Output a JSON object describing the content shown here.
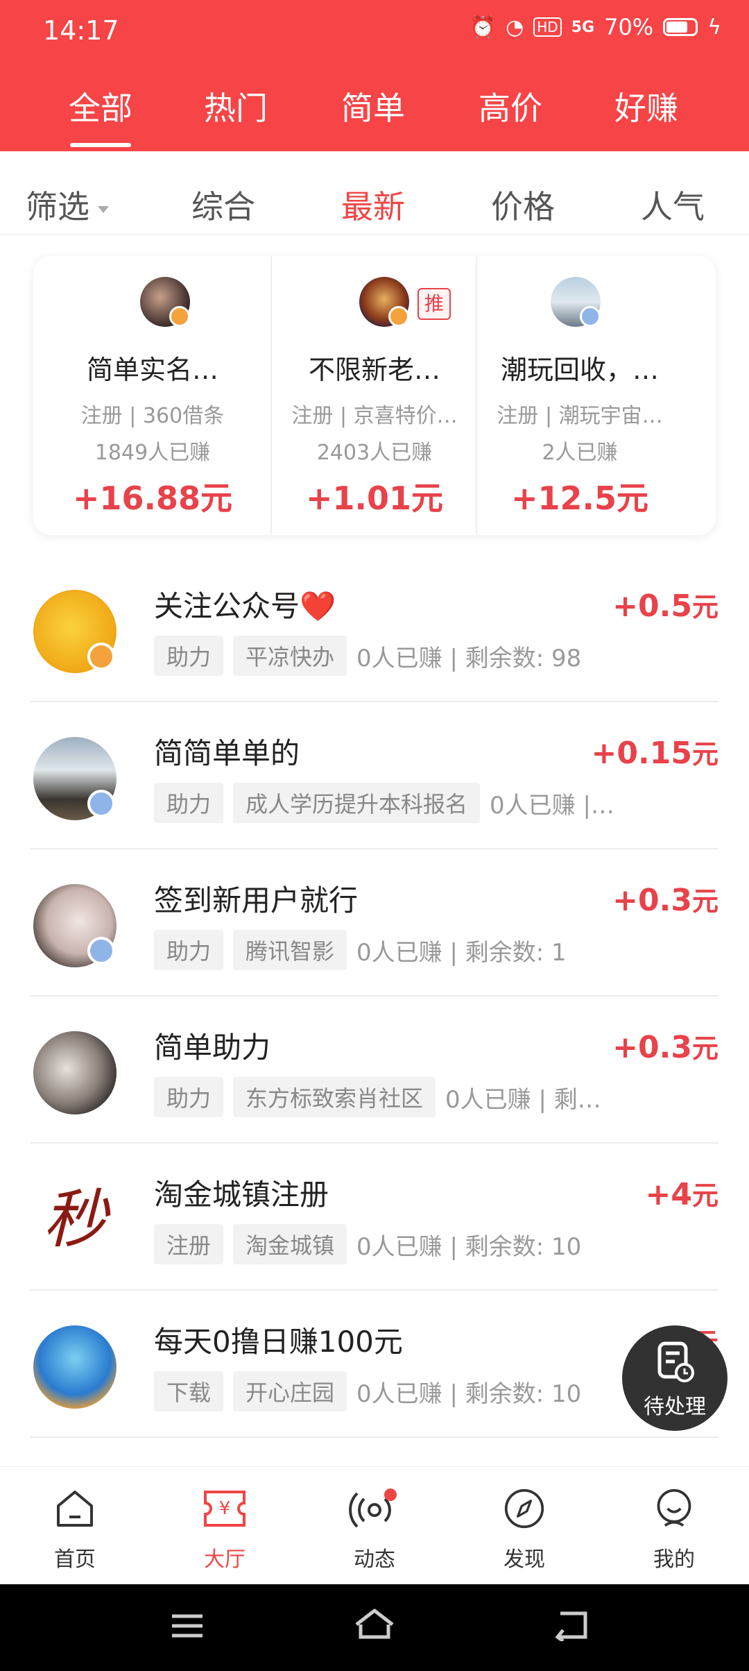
{
  "status_bar": {
    "time": "14:17",
    "battery_percent": "70%",
    "network": "5G",
    "hd": "HD"
  },
  "top_tabs": [
    {
      "label": "全部",
      "active": true
    },
    {
      "label": "热门",
      "active": false
    },
    {
      "label": "简单",
      "active": false
    },
    {
      "label": "高价",
      "active": false
    },
    {
      "label": "好赚",
      "active": false
    }
  ],
  "sort_bar": {
    "filter_label": "筛选",
    "options": [
      "综合",
      "最新",
      "价格",
      "人气"
    ],
    "active": "最新"
  },
  "featured": [
    {
      "title": "简单实名…",
      "sub": "注册 | 360借条",
      "count": "1849人已赚",
      "price": "+16.88元",
      "recommended": false
    },
    {
      "title": "不限新老…",
      "sub": "注册 | 京喜特价…",
      "count": "2403人已赚",
      "price": "+1.01元",
      "recommended": true,
      "recommend_label": "推"
    },
    {
      "title": "潮玩回收，…",
      "sub": "注册 | 潮玩宇宙…",
      "count": "2人已赚",
      "price": "+12.5元",
      "recommended": false
    }
  ],
  "tasks": [
    {
      "title": "关注公众号❤️",
      "price_num": "+0.5",
      "price_unit": "元",
      "tag1": "助力",
      "tag2": "平凉快办",
      "meta": "0人已赚 | 剩余数: 98"
    },
    {
      "title": "简简单单的",
      "price_num": "+0.15",
      "price_unit": "元",
      "tag1": "助力",
      "tag2": "成人学历提升本科报名",
      "meta": "0人已赚 |…"
    },
    {
      "title": "签到新用户就行",
      "price_num": "+0.3",
      "price_unit": "元",
      "tag1": "助力",
      "tag2": "腾讯智影",
      "meta": "0人已赚 | 剩余数: 1"
    },
    {
      "title": "简单助力",
      "price_num": "+0.3",
      "price_unit": "元",
      "tag1": "助力",
      "tag2": "东方标致索肖社区",
      "meta": "0人已赚 | 剩…"
    },
    {
      "title": "淘金城镇注册",
      "price_num": "+4",
      "price_unit": "元",
      "tag1": "注册",
      "tag2": "淘金城镇",
      "meta": "0人已赚 | 剩余数: 10"
    },
    {
      "title": "每天0撸日赚100元",
      "price_num": "+2",
      "price_unit": "元",
      "tag1": "下载",
      "tag2": "开心庄园",
      "meta": "0人已赚 | 剩余数: 10"
    }
  ],
  "row5_avatar_text": "秒",
  "floating_button": {
    "label": "待处理"
  },
  "bottom_nav": [
    {
      "label": "首页",
      "icon": "home-icon",
      "active": false
    },
    {
      "label": "大厅",
      "icon": "hall-ticket-icon",
      "active": true
    },
    {
      "label": "动态",
      "icon": "broadcast-icon",
      "active": false
    },
    {
      "label": "发现",
      "icon": "compass-icon",
      "active": false
    },
    {
      "label": "我的",
      "icon": "profile-icon",
      "active": false
    }
  ],
  "colors": {
    "brand": "#f74446",
    "price": "#e8424a",
    "active_text": "#f04545"
  }
}
